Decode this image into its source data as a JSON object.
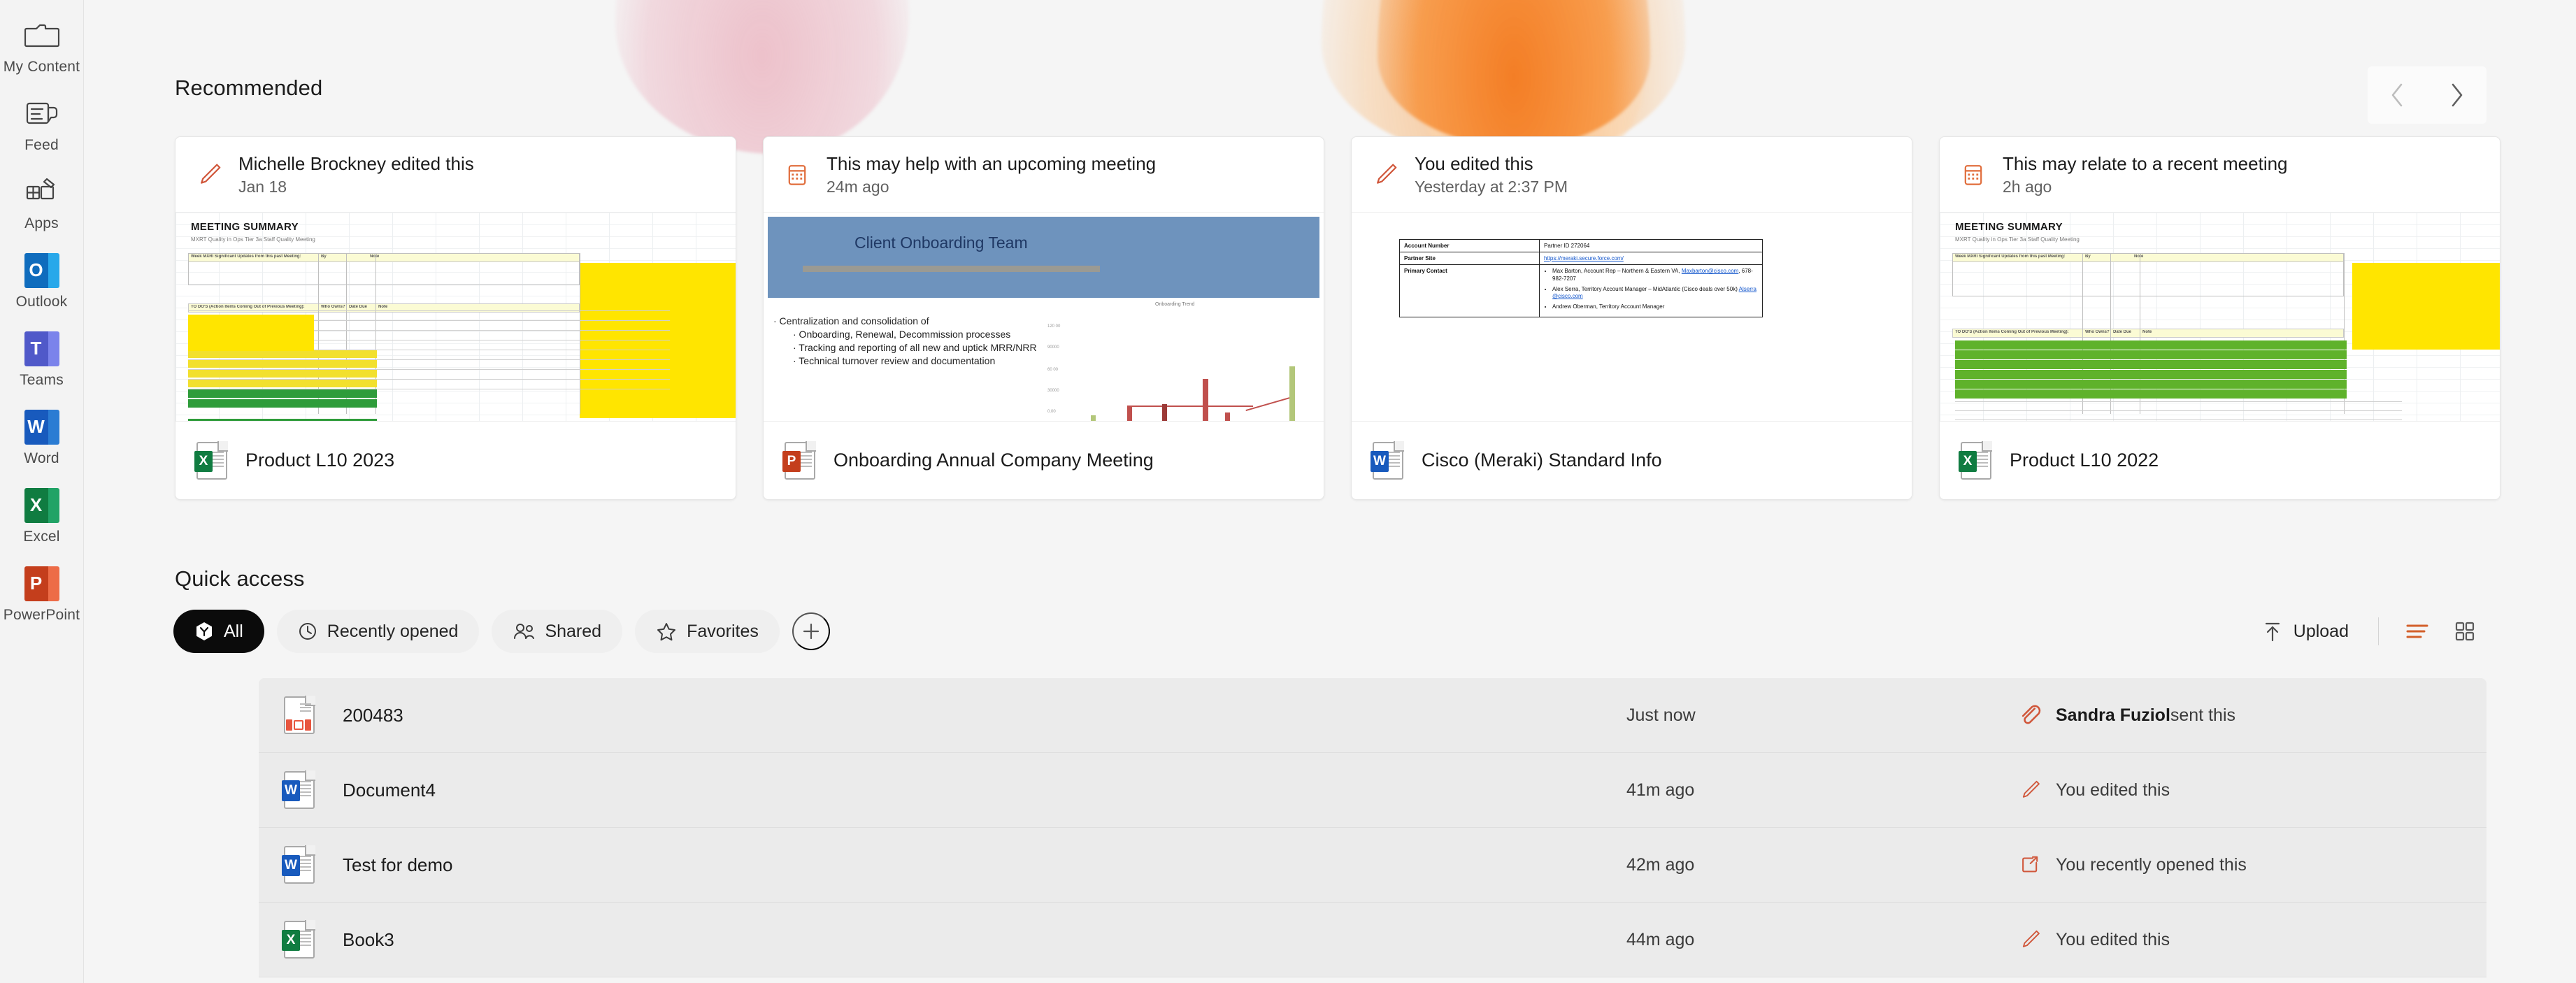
{
  "sidebar": {
    "items": [
      {
        "label": "My Content",
        "icon": "folder-icon",
        "type": "glyph"
      },
      {
        "label": "Feed",
        "icon": "feed-icon",
        "type": "glyph"
      },
      {
        "label": "Apps",
        "icon": "apps-icon",
        "type": "glyph"
      },
      {
        "label": "Outlook",
        "icon": "outlook-icon",
        "type": "tile",
        "letter": "O",
        "color": "#0f6cbd",
        "wing": "#28a8ea"
      },
      {
        "label": "Teams",
        "icon": "teams-icon",
        "type": "tile",
        "letter": "T",
        "color": "#5059c9",
        "wing": "#7b83eb"
      },
      {
        "label": "Word",
        "icon": "word-icon",
        "type": "tile",
        "letter": "W",
        "color": "#185abd",
        "wing": "#2b7cd3"
      },
      {
        "label": "Excel",
        "icon": "excel-icon",
        "type": "tile",
        "letter": "X",
        "color": "#107c41",
        "wing": "#21a366"
      },
      {
        "label": "PowerPoint",
        "icon": "powerpoint-icon",
        "type": "tile",
        "letter": "P",
        "color": "#c43e1c",
        "wing": "#ed6c47"
      }
    ]
  },
  "recommended": {
    "title": "Recommended",
    "nav": {
      "prev_label": "Previous",
      "next_label": "Next"
    },
    "cards": [
      {
        "activity": "Michelle Brockney edited this",
        "timestamp": "Jan 18",
        "activity_icon": "pencil-icon",
        "file_name": "Product L10 2023",
        "file_type": "excel",
        "badge_letter": "X",
        "badge_color": "#107c41",
        "thumb": {
          "kind": "spreadsheet",
          "title": "MEETING SUMMARY",
          "subtitle": "MXRT Quality in Ops Tier 3a Staff Quality Meeting",
          "header_rows": [
            "Week MXRI Significant Updates from this past Meeting:",
            "TO DO'S (Action Items Coming Out of Previous Meeting):"
          ],
          "col_headers": [
            "By",
            "Note",
            "Who Owns?",
            "Date Due"
          ]
        }
      },
      {
        "activity": "This may help with an upcoming meeting",
        "timestamp": "24m ago",
        "activity_icon": "calendar-icon",
        "file_name": "Onboarding Annual Company Meeting",
        "file_type": "powerpoint",
        "badge_letter": "P",
        "badge_color": "#c43e1c",
        "thumb": {
          "kind": "slide",
          "banner_title": "Client Onboarding Team",
          "bullets": [
            "Centralization and consolidation of",
            "Onboarding, Renewal, Decommission processes",
            "Tracking and reporting of all new and uptick MRR/NRR",
            "Technical turnover review and documentation"
          ],
          "chart_caption": "Onboarding Trend"
        }
      },
      {
        "activity": "You edited this",
        "timestamp": "Yesterday at 2:37 PM",
        "activity_icon": "pencil-icon",
        "file_name": "Cisco (Meraki) Standard Info",
        "file_type": "word",
        "badge_letter": "W",
        "badge_color": "#185abd",
        "thumb": {
          "kind": "worddoc",
          "rows": [
            {
              "label": "Account Number",
              "value": "Partner ID 272064"
            },
            {
              "label": "Partner Site",
              "value": "https://meraki.secure.force.com/",
              "is_link": true
            },
            {
              "label": "Primary Contact",
              "bullets": [
                "Max Barton, Account Rep – Northern & Eastern VA, Maxbarton@cisco.com, 678-982-7207",
                "Alex Serra, Territory Account Manager – MidAtlantic (Cisco deals over 50k) Alserra@cisco.com",
                "Andrew Oberman, Territory Account Manager"
              ]
            }
          ]
        }
      },
      {
        "activity": "This may relate to a recent meeting",
        "timestamp": "2h ago",
        "activity_icon": "calendar-icon",
        "file_name": "Product L10 2022",
        "file_type": "excel",
        "badge_letter": "X",
        "badge_color": "#107c41",
        "thumb": {
          "kind": "spreadsheet",
          "title": "MEETING SUMMARY",
          "subtitle": "MXRT Quality in Ops Tier 3a Staff Quality Meeting",
          "header_rows": [
            "Week MXRI Significant Updates from this past Meeting:",
            "TO DO'S (Action Items Coming Out of Previous Meeting):"
          ],
          "col_headers": [
            "By",
            "Note",
            "Who Owns?",
            "Date Due"
          ]
        }
      }
    ]
  },
  "quick_access": {
    "title": "Quick access",
    "filters": [
      {
        "label": "All",
        "icon": "all-hex-icon",
        "active": true
      },
      {
        "label": "Recently opened",
        "icon": "clock-icon",
        "active": false
      },
      {
        "label": "Shared",
        "icon": "people-icon",
        "active": false
      },
      {
        "label": "Favorites",
        "icon": "star-icon",
        "active": false
      }
    ],
    "add_filter_label": "+",
    "toolbar": {
      "upload_label": "Upload",
      "upload_icon": "upload-arrow-icon",
      "list_view_icon": "list-view-icon",
      "grid_view_icon": "grid-view-icon",
      "active_view": "list",
      "active_view_color": "#d35f2a"
    },
    "rows": [
      {
        "name": "200483",
        "file_type": "pdf",
        "badge_letter": "",
        "badge_color": "#e8563f",
        "time": "Just now",
        "activity_icon": "paperclip-icon",
        "activity_who": "Sandra Fuziol",
        "activity_text": " sent this"
      },
      {
        "name": "Document4",
        "file_type": "word",
        "badge_letter": "W",
        "badge_color": "#185abd",
        "time": "41m ago",
        "activity_icon": "pencil-icon",
        "activity_who": "",
        "activity_text": "You edited this"
      },
      {
        "name": "Test for demo",
        "file_type": "word",
        "badge_letter": "W",
        "badge_color": "#185abd",
        "time": "42m ago",
        "activity_icon": "open-external-icon",
        "activity_who": "",
        "activity_text": "You recently opened this"
      },
      {
        "name": "Book3",
        "file_type": "excel",
        "badge_letter": "X",
        "badge_color": "#107c41",
        "time": "44m ago",
        "activity_icon": "pencil-icon",
        "activity_who": "",
        "activity_text": "You edited this"
      }
    ]
  },
  "colors": {
    "accent_orange": "#d35f2a",
    "page_bg": "#f5f5f5",
    "rail_bg": "#f3f3f3",
    "row_bg": "#ebebeb"
  }
}
